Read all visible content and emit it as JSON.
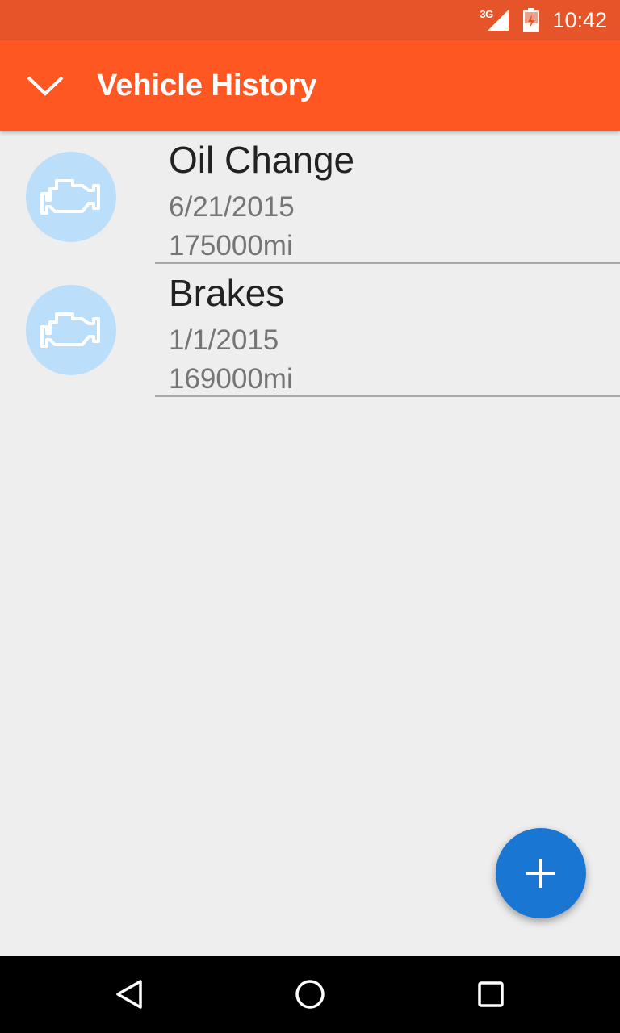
{
  "status_bar": {
    "network": "3G",
    "time": "10:42"
  },
  "app_bar": {
    "title": "Vehicle History",
    "nav_icon": "chevron-down-icon"
  },
  "entries": [
    {
      "title": "Oil Change",
      "date": "6/21/2015",
      "mileage": "175000mi",
      "icon": "engine-icon"
    },
    {
      "title": "Brakes",
      "date": "1/1/2015",
      "mileage": "169000mi",
      "icon": "engine-icon"
    }
  ],
  "fab": {
    "icon": "plus-icon"
  },
  "system_nav": {
    "back_icon": "back-icon",
    "home_icon": "home-icon",
    "recents_icon": "recents-icon"
  },
  "colors": {
    "status_bar": "#e6552a",
    "app_bar": "#ff5722",
    "background": "#eeeeee",
    "avatar": "#bbdefb",
    "fab": "#1976d2",
    "title_text": "#222222",
    "secondary_text": "#757575"
  }
}
